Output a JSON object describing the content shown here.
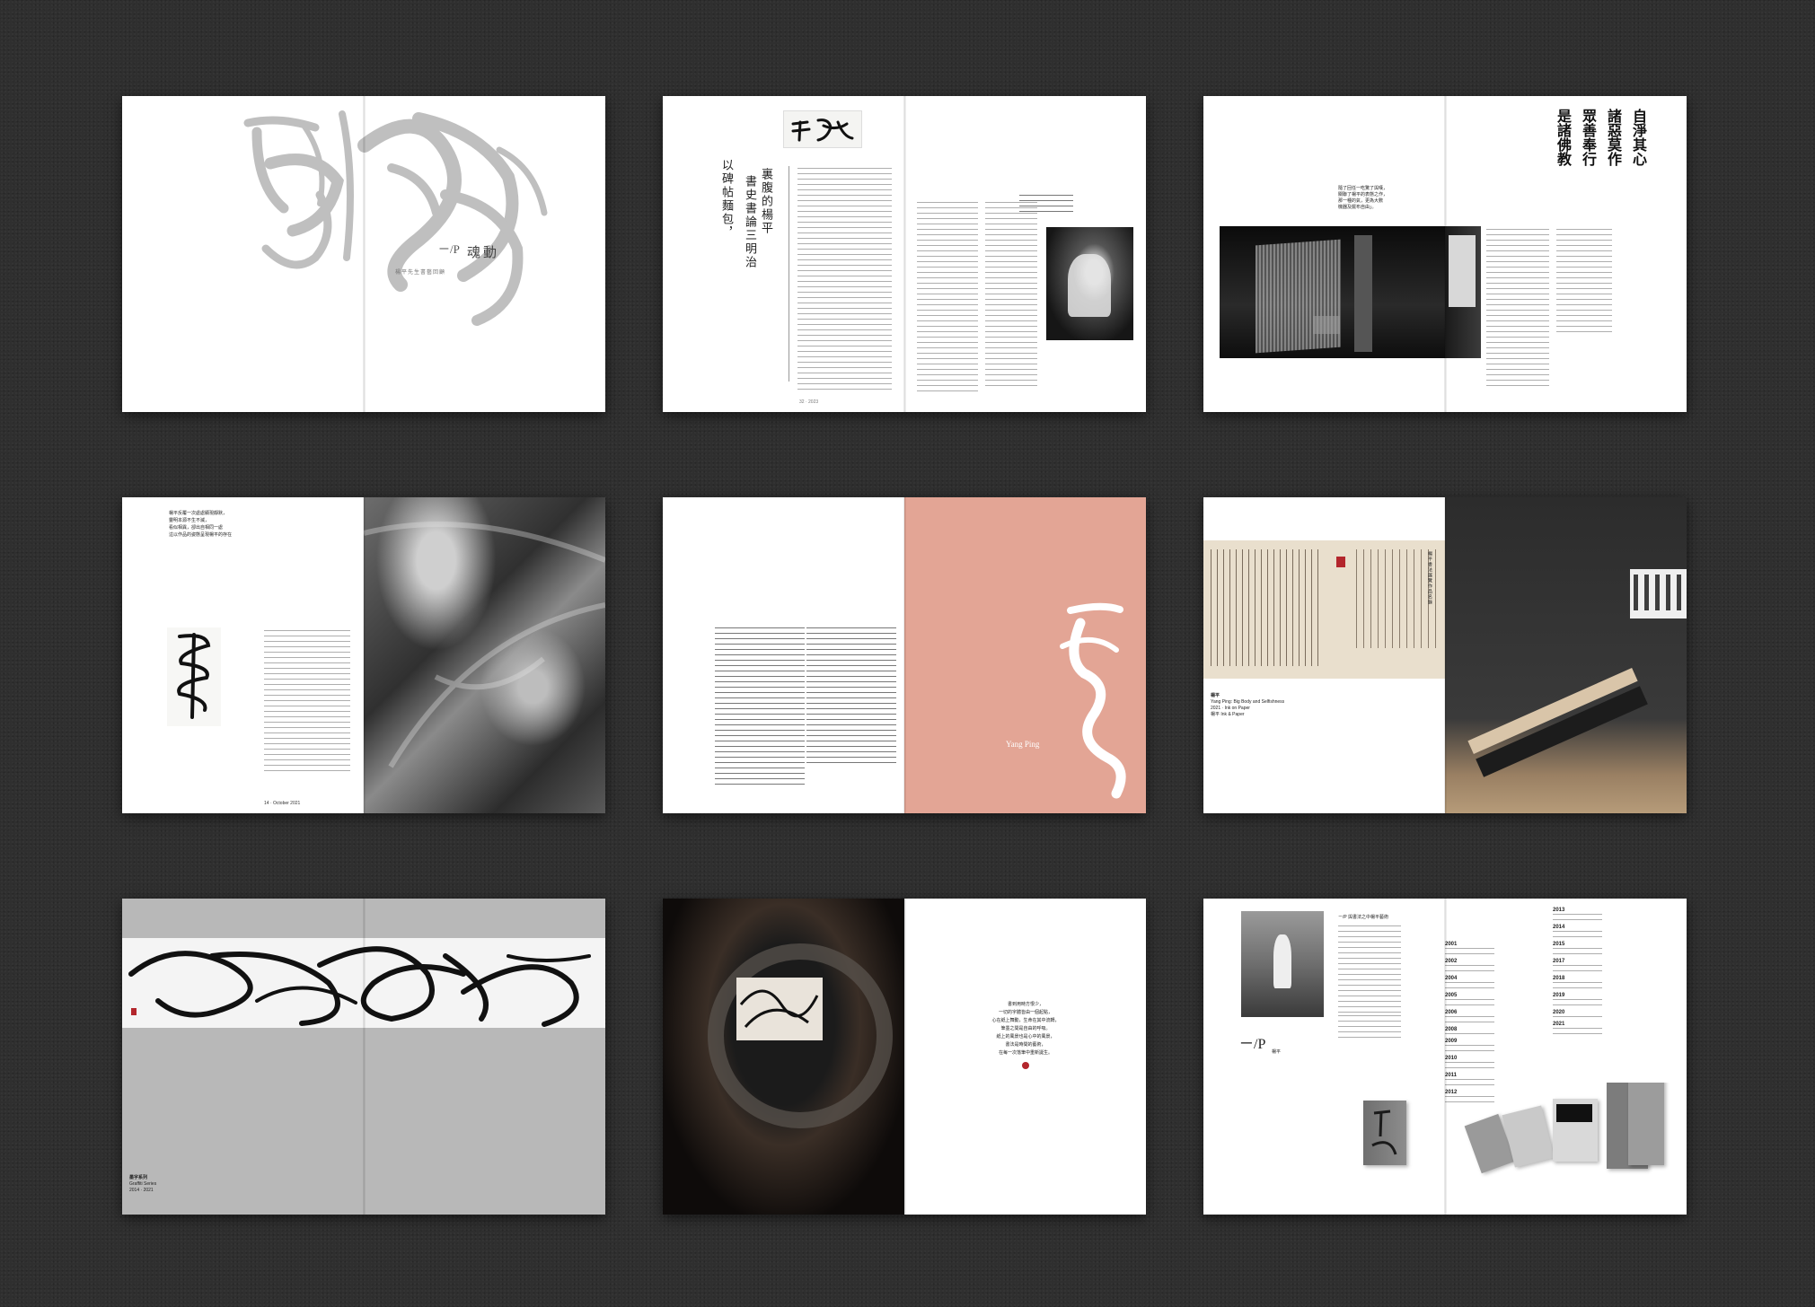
{
  "spreads": [
    {
      "id": 1,
      "logo": "ㄧ/P",
      "title_cn": "魂動",
      "subtitle_cn": "楊平先生書藝回顧"
    },
    {
      "id": 2,
      "vertical_title": [
        "裏腹的楊平",
        "書史書論三明治",
        "以碑帖麵包，"
      ],
      "folio": "32 · 2023"
    },
    {
      "id": 3,
      "note_lines": [
        "隨了回任一吃驚了與嘆，",
        "關聯了楊平的表態之作，",
        "那一種的氣，更為大數",
        "機器及擺布自由」。"
      ],
      "calligraphy": [
        "自淨其心",
        "諸惡莫作",
        "眾善奉行",
        "是諸佛教"
      ]
    },
    {
      "id": 4,
      "intro_lines": [
        "楊平反覆一次處處顯現靜默，",
        "靈明本源不生不滅，",
        "看似相異，卻出自相同一處",
        "這以作品的姿態呈現楊平的存在"
      ],
      "folio": "14 · October 2021"
    },
    {
      "id": 5,
      "sig": "Yang Ping"
    },
    {
      "id": 6,
      "caption": [
        "楊平",
        "Yang Ping: Big Body and Selfishness",
        "2021 · Ink on Paper",
        "楊平 Ink & Paper"
      ],
      "vertical": "楊平書法展覽作品名錄"
    },
    {
      "id": 7,
      "caption": [
        "墨字系列",
        "Graffiti Series",
        "2014 · 2021"
      ]
    },
    {
      "id": 8,
      "poem": [
        "書到用時方恨少，",
        "一切的字體皆由一個起點，",
        "心在紙上舞動，生命在其中流轉，",
        "筆墨之間是自由的呼吸。",
        "紙上的風景也是心中的風景，",
        "書法是時間的藝術，",
        "在每一次落筆中重新誕生。"
      ]
    },
    {
      "id": 9,
      "logo": "ㄧ/P",
      "name": "楊平",
      "years_left": [
        "2001",
        "2002",
        "2004",
        "2005",
        "2006",
        "2008",
        "2009",
        "2010",
        "2011",
        "2012"
      ],
      "years_right": [
        "2013",
        "2014",
        "2015",
        "2017",
        "2018",
        "2019",
        "2020",
        "2021"
      ],
      "intro": [
        "ㄧ/P 與書法之中楊平藝術"
      ]
    }
  ],
  "colors": {
    "background": "#2f2f2f",
    "paper": "#ffffff",
    "accent_pink": "#e3a595",
    "seal_red": "#b3262c",
    "gray_page": "#b8b8b8"
  }
}
